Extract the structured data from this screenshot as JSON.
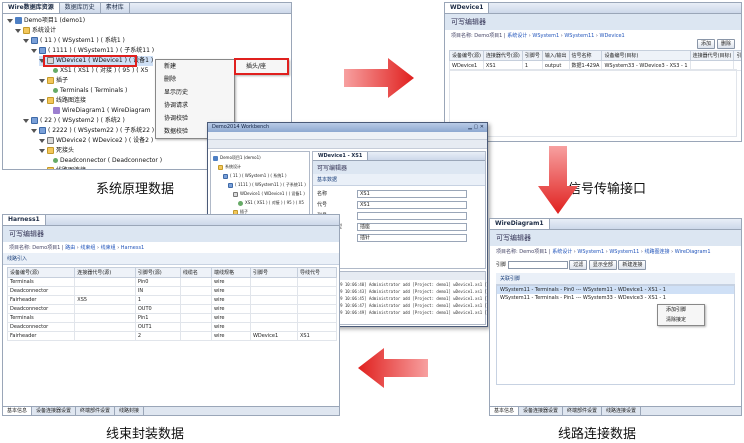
{
  "tl": {
    "tabs": [
      "Wire数据库资源",
      "数据库历史",
      "素材库"
    ],
    "tree": [
      {
        "indent": 0,
        "icon": "proj",
        "label": "Demo项目1 (demo1)"
      },
      {
        "indent": 1,
        "icon": "folder",
        "label": "系统设计"
      },
      {
        "indent": 2,
        "icon": "sys",
        "label": "( 11 ) ( WSystem1 ) ( 系统1 )"
      },
      {
        "indent": 3,
        "icon": "sys",
        "label": "( 1111 ) ( WSystem11 ) ( 子系统11 )"
      },
      {
        "indent": 4,
        "icon": "dev",
        "label": "WDevice1 ( WDevice1 ) ( 设备1 )"
      },
      {
        "indent": 5,
        "icon": "pin",
        "label": "XS1 ( XS1 ) ( 对接 ) ( 95 ) ( X5"
      },
      {
        "indent": 4,
        "icon": "folder",
        "label": "插子"
      },
      {
        "indent": 5,
        "icon": "pin",
        "label": "Terminals ( Terminals )"
      },
      {
        "indent": 4,
        "icon": "folder",
        "label": "线路图连接"
      },
      {
        "indent": 5,
        "icon": "diag",
        "label": "WireDiagram1 ( WireDiagram"
      },
      {
        "indent": 2,
        "icon": "sys",
        "label": "( 22 ) ( WSystem2 ) ( 系统2 )"
      },
      {
        "indent": 3,
        "icon": "sys",
        "label": "( 2222 ) ( WSystem22 ) ( 子系统22 )"
      },
      {
        "indent": 4,
        "icon": "dev",
        "label": "WDevice2 ( WDevice2 ) ( 设备2 )"
      },
      {
        "indent": 4,
        "icon": "folder",
        "label": "死接头"
      },
      {
        "indent": 5,
        "icon": "pin",
        "label": "Deadconnector ( Deadconnector )"
      },
      {
        "indent": 4,
        "icon": "folder",
        "label": "线路图连接"
      }
    ],
    "context_menu": [
      "新建",
      "删除",
      "显示历史",
      "协调请求",
      "协调校验",
      "数据校验"
    ],
    "submenu": "插头/座"
  },
  "tr": {
    "tab": "WDevice1",
    "title": "可写编辑器",
    "breadcrumb": [
      "项目名称: Demo项目1",
      "系统设计",
      "WSystem1",
      "WSystem11",
      "WDevice1"
    ],
    "headers": [
      "设备编号(源)",
      "连接器代号(源)",
      "引脚号",
      "输入/输出",
      "信号名称",
      "设备编号(目标)",
      "连接器代号(目标)",
      "引脚号(目标)"
    ],
    "row": [
      "WDevice1",
      "XS1",
      "1",
      "output",
      "数据1-429A",
      "WSystem33 - WDevice3 - XS3 - 1",
      "",
      ""
    ],
    "buttons": [
      "添加",
      "删除"
    ]
  },
  "center": {
    "title": "Demo2014 Workbench",
    "tab": "WDevice1 - XS1",
    "form_title": "可写编辑器",
    "section": "基本数据",
    "fields": [
      {
        "label": "名称",
        "value": "XS1"
      },
      {
        "label": "代号",
        "value": "XS1"
      },
      {
        "label": "型号",
        "value": ""
      },
      {
        "label": "接插件类型",
        "value": "插座"
      },
      {
        "label": "插孔类型",
        "value": "插针"
      }
    ],
    "console_title": "Console",
    "log": [
      "[2013-12-09 10:06:40] Administrator add [Project: demo1] wDevice1.xs1 [1111987]",
      "[2013-12-09 10:06:43] Administrator add [Project: demo1] wDevice1.xs1 [1111987]",
      "[2013-12-09 10:06:45] Administrator add [Project: demo1] wDevice1.xs1 [1111987]",
      "[2013-12-09 10:06:47] Administrator add [Project: demo1] wDevice1.xs1 [1111987]",
      "[2013-12-09 10:06:49] Administrator add [Project: demo1] wDevice1.xs1 [1111987]"
    ]
  },
  "bl": {
    "tab": "Harness1",
    "title": "可写编辑器",
    "breadcrumb": [
      "项目名称: Demo项目1",
      "路由",
      "线束组",
      "线束组",
      "Harness1"
    ],
    "section": "线路引入",
    "headers": [
      "设备编号(源)",
      "连接器代号(源)",
      "引脚号(源)",
      "线缆名",
      "端线规格",
      "引脚号",
      "导线代号"
    ],
    "rows": [
      [
        "Terminals",
        "",
        "Pin0",
        "",
        "wire",
        "",
        ""
      ],
      [
        "Deadconnector",
        "",
        "IN",
        "",
        "wire",
        "",
        ""
      ],
      [
        "Fairheader",
        "XS5",
        "1",
        "",
        "wire",
        "",
        ""
      ],
      [
        "Deadconnector",
        "",
        "OUT0",
        "",
        "wire",
        "",
        ""
      ],
      [
        "Terminals",
        "",
        "Pin1",
        "",
        "wire",
        "",
        ""
      ],
      [
        "Deadconnector",
        "",
        "OUT1",
        "",
        "wire",
        "",
        ""
      ],
      [
        "Fairheader",
        "",
        "2",
        "",
        "wire",
        "WDevice1",
        "XS1"
      ]
    ],
    "bottom_tabs": [
      "基本信息",
      "设备连接器设置",
      "终端部件设置",
      "线路封接"
    ]
  },
  "br": {
    "tab": "WireDiagram1",
    "title": "可写编辑器",
    "breadcrumb": [
      "项目名称: Demo项目1",
      "系统设计",
      "WSystem1",
      "WSystem11",
      "线路图连接",
      "WireDiagram1"
    ],
    "section": "关联引脚",
    "search_label": "引脚",
    "buttons": [
      "过滤",
      "显示全部",
      "新建连接"
    ],
    "rows": [
      "WSystem11 - Terminals - Pin0 --- WSystem11 - WDevice1 - XS1 - 1",
      "WSystem11 - Terminals - Pin1 --- WSystem33 - WDevice3 - XS1 - 1"
    ],
    "popup": [
      "添加引脚",
      "清除接定"
    ],
    "bottom_tabs": [
      "基本信息",
      "设备连接器设置",
      "终端部件设置",
      "线路连接设置"
    ]
  },
  "captions": {
    "system": "系统原理数据",
    "signal": "信号传输接口",
    "harness": "线束封装数据",
    "wiring": "线路连接数据"
  },
  "colors": {
    "arrow": "#e0201e",
    "highlight": "#e0201e"
  }
}
